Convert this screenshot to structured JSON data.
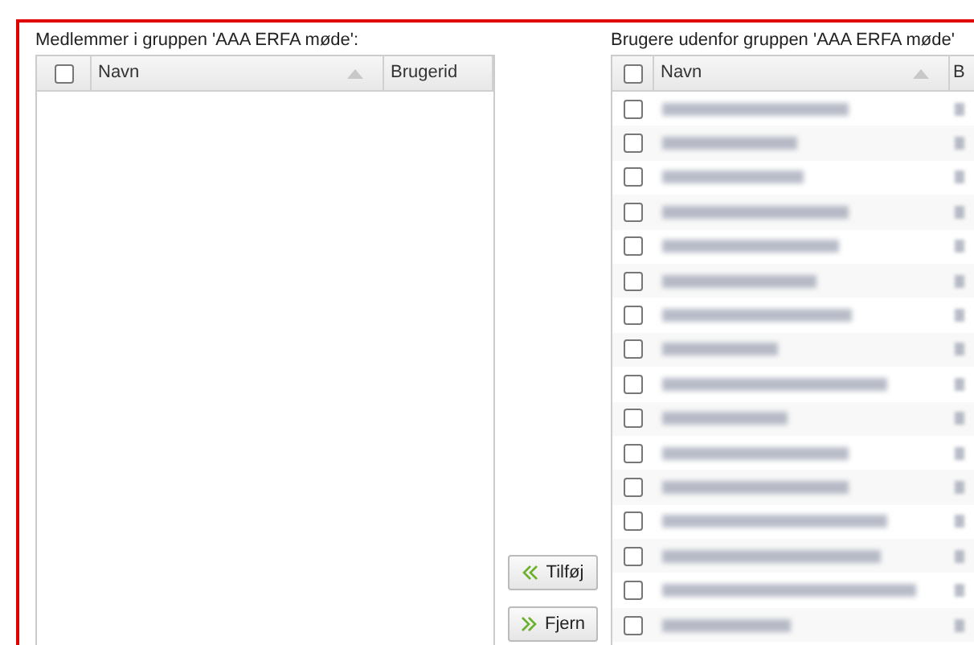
{
  "members": {
    "title": "Medlemmer i gruppen 'AAA ERFA møde':",
    "select_all": {
      "checked": false
    },
    "columns": [
      {
        "label": "Navn",
        "sorted": true
      },
      {
        "label": "Brugerid",
        "sorted": false
      }
    ]
  },
  "actions": [
    {
      "kind": "add",
      "label": "Tilføj"
    },
    {
      "kind": "remove",
      "label": "Fjern"
    }
  ],
  "non_members": {
    "title": "Brugere udenfor gruppen 'AAA ERFA møde'",
    "select_all": {
      "checked": false
    },
    "columns": [
      {
        "label": "Navn",
        "sorted": true
      },
      {
        "label": "B",
        "sorted": false
      }
    ],
    "rows": [
      {
        "checked": false
      },
      {
        "checked": false
      },
      {
        "checked": false
      },
      {
        "checked": false
      },
      {
        "checked": false
      },
      {
        "checked": false
      },
      {
        "checked": false
      },
      {
        "checked": false
      },
      {
        "checked": false
      },
      {
        "checked": false
      },
      {
        "checked": false
      },
      {
        "checked": false
      },
      {
        "checked": false
      },
      {
        "checked": false
      },
      {
        "checked": false
      },
      {
        "checked": false
      }
    ]
  }
}
